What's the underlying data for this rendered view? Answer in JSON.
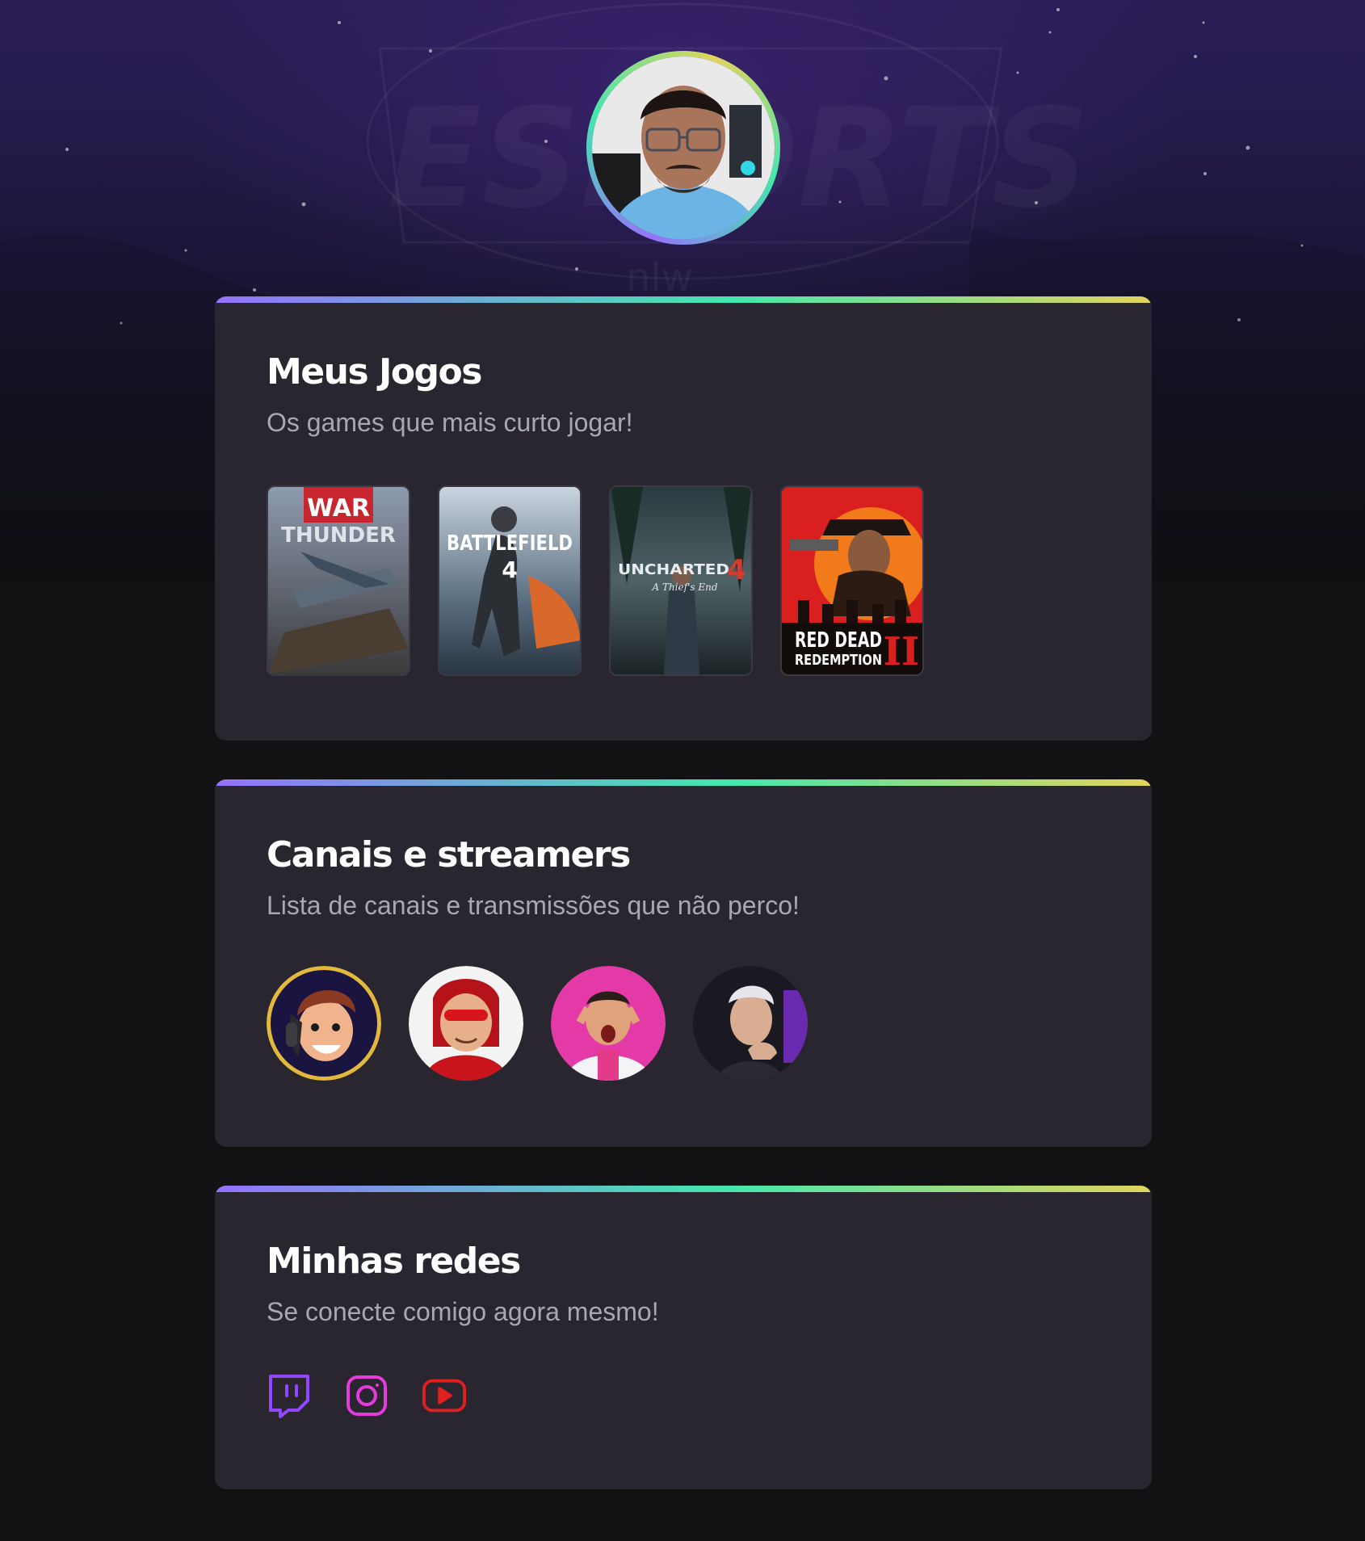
{
  "profile": {
    "avatar_name": "profile-photo"
  },
  "sections": {
    "games": {
      "title": "Meus Jogos",
      "subtitle": "Os games que mais curto jogar!",
      "items": [
        {
          "id": "war-thunder",
          "cover_line1": "WAR",
          "cover_line2": "THUNDER"
        },
        {
          "id": "battlefield-4",
          "cover_line1": "BATTLEFIELD",
          "cover_line2": "4"
        },
        {
          "id": "uncharted-4",
          "cover_line1": "UNCHARTED",
          "cover_line2": "A Thief's End",
          "cover_num": "4"
        },
        {
          "id": "red-dead-redemption-2",
          "cover_line1": "RED DEAD",
          "cover_line2": "REDEMPTION",
          "cover_num": "II"
        }
      ]
    },
    "streamers": {
      "title": "Canais e streamers",
      "subtitle": "Lista de canais e transmissões que não perco!",
      "items": [
        {
          "id": "streamer-1"
        },
        {
          "id": "streamer-2"
        },
        {
          "id": "streamer-3"
        },
        {
          "id": "streamer-4"
        }
      ]
    },
    "socials": {
      "title": "Minhas redes",
      "subtitle": "Se conecte comigo agora mesmo!",
      "items": [
        {
          "id": "twitch",
          "icon": "twitch-icon",
          "color": "#9146ff"
        },
        {
          "id": "instagram",
          "icon": "instagram-icon",
          "color": "#e63bdc"
        },
        {
          "id": "youtube",
          "icon": "youtube-icon",
          "color": "#e01f1f"
        }
      ]
    }
  },
  "colors": {
    "background": "#121214",
    "card": "#29262f",
    "accent_gradient": [
      "#9572fc",
      "#43e7ad",
      "#e2d45c"
    ]
  }
}
